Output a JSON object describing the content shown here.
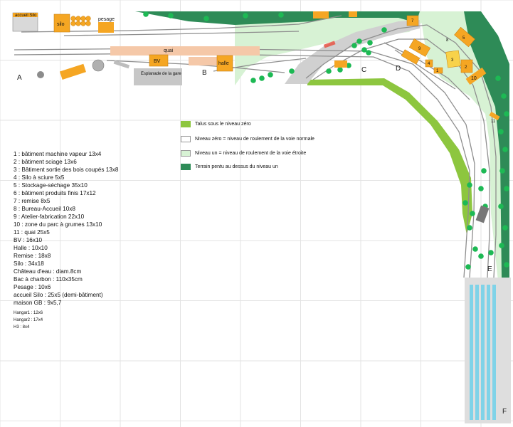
{
  "colors": {
    "slope_below_zero": "#8dc63f",
    "level_zero": "#ffffff",
    "level_one": "#d7f2d4",
    "steep_terrain": "#2e8b57",
    "building": "#f5a623",
    "quay": "#f5c8a8",
    "track": "#8e8e8e",
    "fiddle_yard": "#7fd3e8"
  },
  "legend": [
    {
      "label": "Talus sous le niveau zéro",
      "swatch": "slope_below_zero"
    },
    {
      "label": "Niveau zéro = niveau de roulement de la voie normale",
      "swatch": "level_zero"
    },
    {
      "label": "Niveau un = niveau de roulement de la voie étroite",
      "swatch": "level_one"
    },
    {
      "label": "Terrain pentu au dessus du niveau un",
      "swatch": "steep_terrain"
    }
  ],
  "list": [
    "1 : bâtiment machine vapeur 13x4",
    "2 : bâtiment sciage 13x6",
    "3 : Bâtiment sortie des bois coupés 13x8",
    "4 : Silo à sciure 5x5",
    "5 : Stockage-séchage 35x10",
    "6 : bâtiment produits finis 17x12",
    "7 : remise 8x5",
    "8 : Bureau-Accueil 10x8",
    "9 : Atelier-fabrication 22x10",
    "10 : zone du parc à grumes 13x10",
    "11 : quai 25x5",
    "BV : 16x10",
    "Halle : 10x10",
    "Remise : 18x8",
    "Silo : 34x18",
    "Château d'eau : diam.8cm",
    "Bac à charbon : 110x35cm",
    "Pesage : 10x6",
    "accueil Silo : 25x5 (demi-bâtiment)",
    "maison GB : 9x5,7"
  ],
  "list_small": [
    "Hangar1 : 12x6",
    "Hangar2 : 17x4",
    "H3 : 8x4"
  ],
  "zones": [
    "A",
    "B",
    "C",
    "D",
    "E",
    "F"
  ],
  "buildings": {
    "accueil_silo": "accueil Silo",
    "silo": "silo",
    "pesage": "pesage",
    "quai": "quai",
    "bv": "BV",
    "halle": "halle",
    "esplanade": "Esplanade de la gare",
    "n1": "1",
    "n2": "2",
    "n3": "3",
    "n4": "4",
    "n5": "5",
    "n7": "7",
    "n8": "8",
    "n9": "9",
    "n10": "10",
    "n11": "11"
  }
}
